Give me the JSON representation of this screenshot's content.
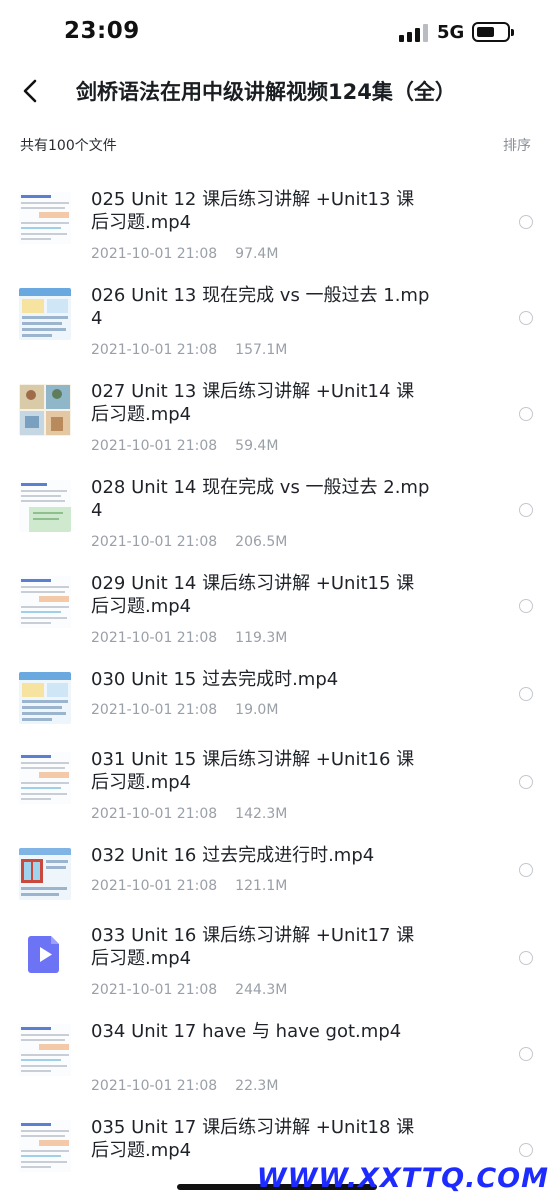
{
  "status_bar": {
    "time": "23:09",
    "network": "5G"
  },
  "nav": {
    "title": "剑桥语法在用中级讲解视频124集（全）"
  },
  "list_header": {
    "count_text": "共有100个文件",
    "sort_label": "排序"
  },
  "files": [
    {
      "name": "025 Unit 12 课后练习讲解 +Unit13 课后习题.mp4",
      "date": "2021-10-01 21:08",
      "size": "97.4M",
      "thumb": "doc"
    },
    {
      "name": "026 Unit 13 现在完成 vs 一般过去 1.mp4",
      "date": "2021-10-01 21:08",
      "size": "157.1M",
      "thumb": "slide"
    },
    {
      "name": "027 Unit 13 课后练习讲解 +Unit14 课后习题.mp4",
      "date": "2021-10-01 21:08",
      "size": "59.4M",
      "thumb": "comic"
    },
    {
      "name": "028 Unit 14 现在完成 vs 一般过去 2.mp4",
      "date": "2021-10-01 21:08",
      "size": "206.5M",
      "thumb": "green"
    },
    {
      "name": "029 Unit 14 课后练习讲解 +Unit15 课后习题.mp4",
      "date": "2021-10-01 21:08",
      "size": "119.3M",
      "thumb": "doc"
    },
    {
      "name": "030 Unit 15 过去完成时.mp4",
      "date": "2021-10-01 21:08",
      "size": "19.0M",
      "thumb": "slide"
    },
    {
      "name": "031 Unit 15 课后练习讲解 +Unit16 课后习题.mp4",
      "date": "2021-10-01 21:08",
      "size": "142.3M",
      "thumb": "doc"
    },
    {
      "name": "032 Unit 16 过去完成进行时.mp4",
      "date": "2021-10-01 21:08",
      "size": "121.1M",
      "thumb": "window"
    },
    {
      "name": "033 Unit 16 课后练习讲解 +Unit17 课后习题.mp4",
      "date": "2021-10-01 21:08",
      "size": "244.3M",
      "thumb": "video"
    },
    {
      "name": "034 Unit 17 have 与 have got.mp4",
      "date": "2021-10-01 21:08",
      "size": "22.3M",
      "thumb": "doc"
    },
    {
      "name": "035 Unit 17 课后练习讲解 +Unit18 课后习题.mp4",
      "date": "",
      "size": "",
      "thumb": "doc"
    }
  ],
  "watermark": "WWW.XXTTQ.COM",
  "colors": {
    "accent_video": "#6c73f5",
    "meta_text": "#9aa0a8",
    "watermark": "#1e2bff"
  }
}
